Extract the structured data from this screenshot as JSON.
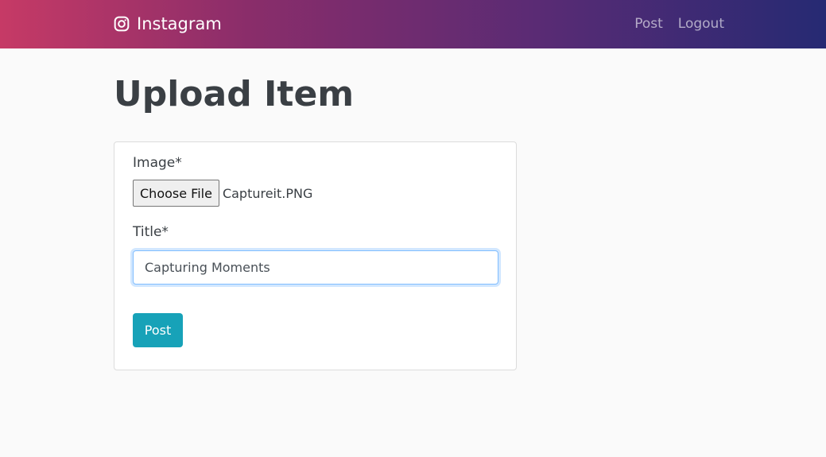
{
  "navbar": {
    "brand": "Instagram",
    "brand_icon": "instagram-icon",
    "links": [
      "Post",
      "Logout"
    ],
    "gradient": [
      "#c63a66",
      "#262a73"
    ]
  },
  "page": {
    "title": "Upload Item"
  },
  "form": {
    "image_label": "Image*",
    "file_button": "Choose File",
    "file_name": "Captureit.PNG",
    "title_label": "Title*",
    "title_value": "Capturing Moments",
    "submit_label": "Post",
    "submit_color": "#17a2b8"
  }
}
